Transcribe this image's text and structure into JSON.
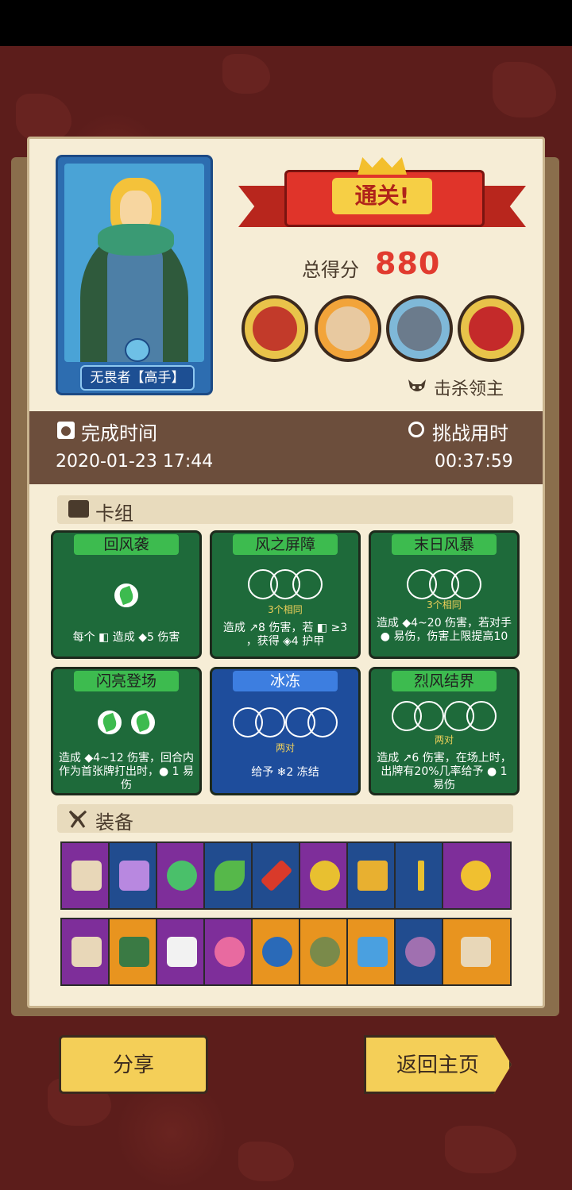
{
  "banner": {
    "title": "通关!"
  },
  "hero": {
    "name": "无畏者【高手】"
  },
  "score": {
    "label": "总得分",
    "value": "880"
  },
  "bosses": {
    "kill_label": "击杀领主",
    "portraits": [
      "boss-1",
      "boss-2",
      "boss-3",
      "boss-4"
    ]
  },
  "time": {
    "complete_label": "完成时间",
    "complete_value": "2020-01-23 17:44",
    "used_label": "挑战用时",
    "used_value": "00:37:59"
  },
  "deck": {
    "title": "卡组",
    "cards": [
      {
        "name": "回风袭",
        "color": "green",
        "orbs": "1-filled",
        "sub": "",
        "desc": "每个 ◧ 造成 ◆5 伤害"
      },
      {
        "name": "风之屏障",
        "color": "green",
        "orbs": "3",
        "sub": "3个相同",
        "desc": "造成 ↗8 伤害，若 ◧ ≥3 ，获得 ◈4 护甲"
      },
      {
        "name": "末日风暴",
        "color": "green",
        "orbs": "3",
        "sub": "3个相同",
        "desc": "造成 ◆4~20 伤害，若对手 ● 易伤，伤害上限提高10"
      },
      {
        "name": "闪亮登场",
        "color": "green",
        "orbs": "2-filled",
        "sub": "",
        "desc": "造成 ◆4~12 伤害，回合内作为首张牌打出时，● 1 易伤"
      },
      {
        "name": "冰冻",
        "color": "blue",
        "orbs": "2x2",
        "sub": "两对",
        "desc": "给予 ❄2 冻结"
      },
      {
        "name": "烈风结界",
        "color": "green",
        "orbs": "2x2",
        "sub": "两对",
        "desc": "造成 ↗6 伤害，在场上时，出牌有20%几率给予 ● 1 易伤"
      }
    ]
  },
  "equipment": {
    "title": "装备",
    "row1": [
      "purple",
      "blue",
      "purple",
      "blue",
      "blue",
      "purple",
      "blue",
      "blue",
      "purple"
    ],
    "row2": [
      "purple",
      "orange",
      "purple",
      "purple",
      "orange",
      "orange",
      "orange",
      "blue",
      "orange"
    ]
  },
  "buttons": {
    "share": "分享",
    "home": "返回主页"
  },
  "colors": {
    "accent_red": "#e13b2f",
    "card_green": "#1e6a3a",
    "card_blue": "#1e4d9c",
    "button_yellow": "#f4cf58"
  }
}
